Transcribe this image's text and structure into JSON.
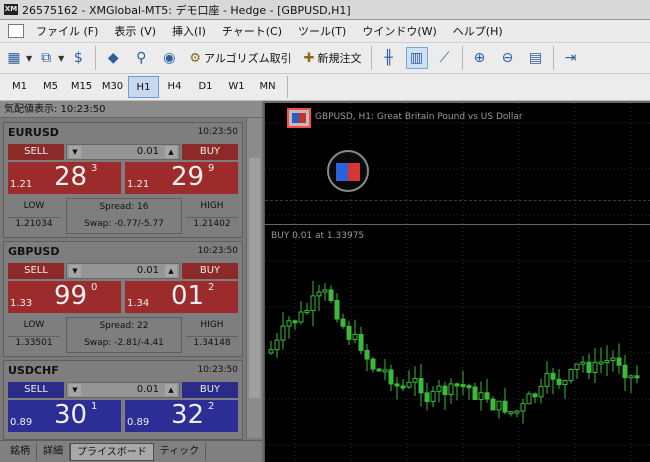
{
  "titlebar": {
    "logo": "XM",
    "title": "26575162 - XMGlobal-MT5: デモ口座 - Hedge - [GBPUSD,H1]"
  },
  "menu": [
    "ファイル (F)",
    "表示 (V)",
    "挿入(I)",
    "チャート(C)",
    "ツール(T)",
    "ウインドウ(W)",
    "ヘルプ(H)"
  ],
  "toolbar": {
    "algo_label": "アルゴリズム取引",
    "order_label": "新規注文"
  },
  "timeframes": [
    "M1",
    "M5",
    "M15",
    "M30",
    "H1",
    "H4",
    "D1",
    "W1",
    "MN"
  ],
  "active_timeframe": "H1",
  "market_watch": {
    "header": "気配値表示: 10:23:50",
    "cards": [
      {
        "symbol": "EURUSD",
        "time": "10:23:50",
        "theme": "red",
        "sell": "SELL",
        "buy": "BUY",
        "lot": "0.01",
        "bid_small": "1.21",
        "bid_big": "28",
        "bid_sup": "3",
        "ask_small": "1.21",
        "ask_big": "29",
        "ask_sup": "9",
        "low_label": "LOW",
        "low_value": "1.21034",
        "high_label": "HIGH",
        "high_value": "1.21402",
        "spread": "Spread: 16",
        "swap": "Swap: -0.77/-5.77"
      },
      {
        "symbol": "GBPUSD",
        "time": "10:23:50",
        "theme": "red",
        "sell": "SELL",
        "buy": "BUY",
        "lot": "0.01",
        "bid_small": "1.33",
        "bid_big": "99",
        "bid_sup": "0",
        "ask_small": "1.34",
        "ask_big": "01",
        "ask_sup": "2",
        "low_label": "LOW",
        "low_value": "1.33501",
        "high_label": "HIGH",
        "high_value": "1.34148",
        "spread": "Spread: 22",
        "swap": "Swap: -2.81/-4.41"
      },
      {
        "symbol": "USDCHF",
        "time": "10:23:50",
        "theme": "blue",
        "sell": "SELL",
        "buy": "BUY",
        "lot": "0.01",
        "bid_small": "0.89",
        "bid_big": "30",
        "bid_sup": "1",
        "ask_small": "0.89",
        "ask_big": "32",
        "ask_sup": "2",
        "low_label": "",
        "low_value": "",
        "high_label": "",
        "high_value": "",
        "spread": "",
        "swap": ""
      }
    ]
  },
  "bottom_tabs": [
    "銘柄",
    "詳細",
    "プライスボード",
    "ティック"
  ],
  "active_bottom_tab": "プライスボード",
  "chart": {
    "title": "GBPUSD, H1:  Great Britain Pound vs US Dollar",
    "buy_label": "BUY 0.01 at 1.33975",
    "colors": {
      "up": "#3cb83c",
      "down": "#3cb83c",
      "bg": "#000000",
      "grid": "#2b2b2b",
      "highlight": "#ff4a4a"
    }
  }
}
